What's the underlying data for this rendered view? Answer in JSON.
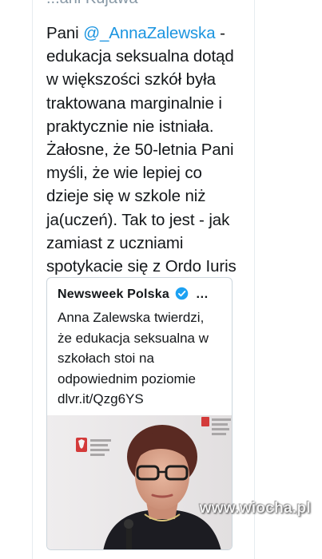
{
  "tweet": {
    "author_partial": "...ani Kujawa",
    "lines": [
      {
        "pre": "Pani ",
        "mention": "@_AnnaZalewska",
        "post": " -"
      },
      {
        "text": "edukacja seksualna dotąd"
      },
      {
        "text": "w większości szkół była"
      },
      {
        "text": "traktowana marginalnie i"
      },
      {
        "text": "praktycznie nie istniała."
      },
      {
        "text": "Żałosne, że 50-letnia Pani"
      },
      {
        "text": "myśli, że wie lepiej co"
      },
      {
        "text": "dzieje się w szkole niż"
      },
      {
        "text": "ja(uczeń). Tak to jest - jak"
      },
      {
        "text": "zamiast z uczniami"
      },
      {
        "text": "spotykacie się z Ordo Iuris"
      }
    ]
  },
  "quoted_tweet": {
    "author": "Newsweek Polska",
    "more": "…",
    "verified_icon": "verified-badge-icon",
    "lines": [
      "Anna Zalewska twierdzi,",
      "że edukacja seksualna w",
      "szkołach stoi na",
      "odpowiednim poziomie",
      "dlvr.it/Qzg6YS"
    ],
    "image_alt": "photo of a woman with glasses in front of a backdrop with a Polish eagle emblem"
  },
  "watermark": "www.wiocha.pl",
  "colors": {
    "link": "#1b95e0",
    "text": "#14171a",
    "muted": "#8899a6",
    "border": "#ccd6dd",
    "verified": "#1da1f2"
  }
}
